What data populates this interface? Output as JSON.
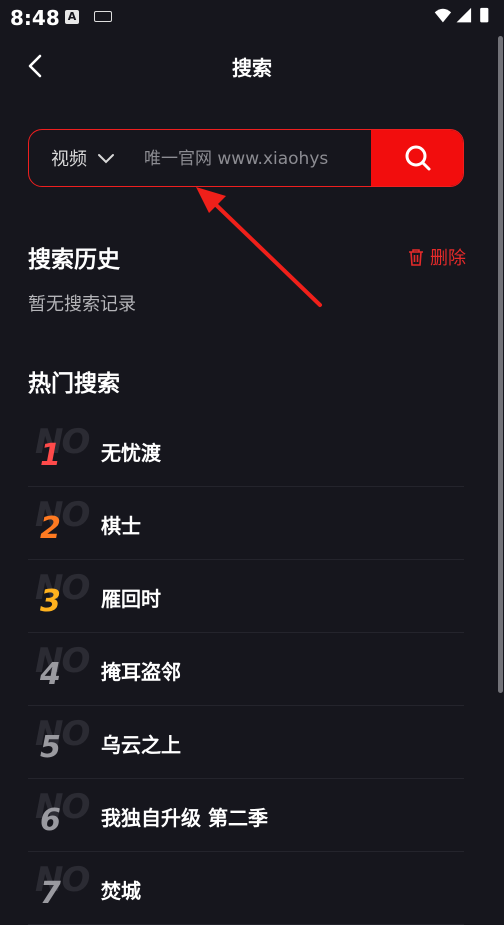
{
  "status_bar": {
    "time": "8:48",
    "a_icon": "A"
  },
  "header": {
    "title": "搜索"
  },
  "search": {
    "type_label": "视频",
    "placeholder": "唯一官网 www.xiaohys"
  },
  "history": {
    "title": "搜索历史",
    "delete_label": "删除",
    "empty_text": "暂无搜索记录"
  },
  "hot": {
    "title": "热门搜索",
    "no_text": "NO",
    "items": [
      {
        "rank": "1",
        "name": "无忧渡",
        "color": "#ff4a4a"
      },
      {
        "rank": "2",
        "name": "棋士",
        "color": "#ff7a21"
      },
      {
        "rank": "3",
        "name": "雁回时",
        "color": "#ffb21e"
      },
      {
        "rank": "4",
        "name": "掩耳盗邻",
        "color": "#9a9aa0"
      },
      {
        "rank": "5",
        "name": "乌云之上",
        "color": "#9a9aa0"
      },
      {
        "rank": "6",
        "name": "我独自升级 第二季",
        "color": "#9a9aa0"
      },
      {
        "rank": "7",
        "name": "焚城",
        "color": "#9a9aa0"
      }
    ]
  },
  "colors": {
    "accent": "#f20d0d",
    "background": "#16161d"
  }
}
